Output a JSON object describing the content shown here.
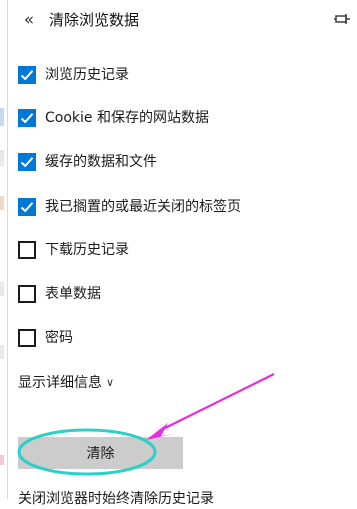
{
  "panel": {
    "title": "清除浏览数据",
    "back_icon": "double-chevron-left-icon",
    "pin_icon": "pin-icon"
  },
  "options": [
    {
      "label": "浏览历史记录",
      "checked": true
    },
    {
      "label": "Cookie 和保存的网站数据",
      "checked": true
    },
    {
      "label": "缓存的数据和文件",
      "checked": true
    },
    {
      "label": "我已搁置的或最近关闭的标签页",
      "checked": true
    },
    {
      "label": "下载历史记录",
      "checked": false
    },
    {
      "label": "表单数据",
      "checked": false
    },
    {
      "label": "密码",
      "checked": false
    }
  ],
  "details_link": "显示详细信息",
  "clear_button": "清除",
  "footer_text": "关闭浏览器时始终清除历史记录",
  "colors": {
    "checkbox_checked": "#0078d7",
    "button_bg": "#cccccc",
    "annotation_arrow": "#e62be6",
    "annotation_ellipse": "#2ad1c9"
  }
}
